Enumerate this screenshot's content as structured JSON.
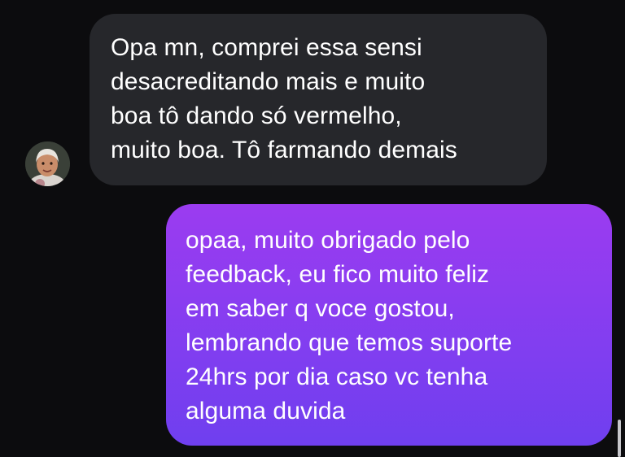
{
  "conversation": {
    "messages": [
      {
        "direction": "incoming",
        "text": "Opa mn, comprei essa sensi\ndesacreditando mais e muito\nboa tô dando só vermelho,\nmuito boa. Tô farmando demais"
      },
      {
        "direction": "outgoing",
        "text": "opaa, muito obrigado pelo\nfeedback, eu fico muito feliz\nem saber q voce gostou,\nlembrando que temos suporte\n24hrs por dia caso vc tenha\nalguma duvida"
      }
    ],
    "avatar_icon": "contact-avatar-photo"
  },
  "colors": {
    "background": "#0c0c0e",
    "incoming_bubble": "#26272b",
    "outgoing_gradient_top": "#9b3cf0",
    "outgoing_gradient_bottom": "#6f3fef",
    "text": "#ffffff"
  }
}
